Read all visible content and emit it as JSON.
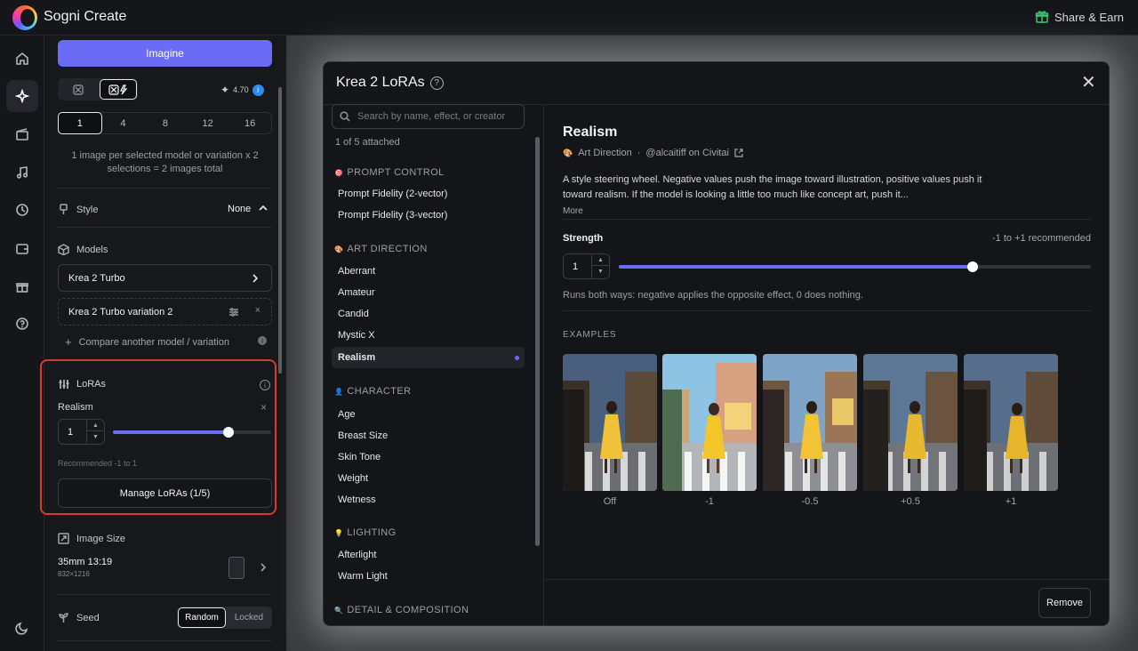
{
  "app": {
    "title": "Sogni Create",
    "share": "Share & Earn"
  },
  "rail": {
    "items": [
      "home-icon",
      "sparkle-icon",
      "clapperboard-icon",
      "music-icon",
      "history-icon",
      "wallet-icon",
      "gift-icon",
      "help-icon"
    ],
    "footer": "moon-icon"
  },
  "panel": {
    "imagine": "Imagine",
    "mode_a": "⛝",
    "mode_b": "⛝ϟ",
    "credit": "4.70",
    "counts": [
      "1",
      "4",
      "8",
      "12",
      "16"
    ],
    "selected_count": "1",
    "count_note": "1 image per selected model or variation x 2 selections = 2 images total",
    "style_label": "Style",
    "style_value": "None",
    "models_label": "Models",
    "models": [
      "Krea 2 Turbo",
      "Krea 2 Turbo variation 2"
    ],
    "compare": "Compare another model / variation",
    "loras": {
      "title": "LoRAs",
      "name": "Realism",
      "value": "1",
      "slider_fraction": 0.73,
      "recommended": "Recommended -1 to 1",
      "manage": "Manage LoRAs (1/5)"
    },
    "image_size_label": "Image Size",
    "image_size_value": "35mm 13:19",
    "image_size_dims": "832×1216",
    "seed_label": "Seed",
    "seed_options": [
      "Random",
      "Locked"
    ]
  },
  "modal": {
    "title": "Krea 2 LoRAs",
    "search_placeholder": "Search by name, effect, or creator",
    "attached": "1 of 5 attached",
    "categories": [
      {
        "name": "PROMPT CONTROL",
        "emoji": "🎯",
        "items": [
          "Prompt Fidelity (2-vector)",
          "Prompt Fidelity (3-vector)"
        ]
      },
      {
        "name": "ART DIRECTION",
        "emoji": "🎨",
        "items": [
          "Aberrant",
          "Amateur",
          "Candid",
          "Mystic X",
          "Realism"
        ]
      },
      {
        "name": "CHARACTER",
        "emoji": "👤",
        "items": [
          "Age",
          "Breast Size",
          "Skin Tone",
          "Weight",
          "Wetness"
        ]
      },
      {
        "name": "LIGHTING",
        "emoji": "💡",
        "items": [
          "Afterlight",
          "Warm Light"
        ]
      },
      {
        "name": "DETAIL & COMPOSITION",
        "emoji": "🔍",
        "items": []
      }
    ],
    "selected": "Realism",
    "detail": {
      "title": "Realism",
      "category": "Art Direction",
      "author": "@alcaitiff on Civitai",
      "description": "A style steering wheel. Negative values push the image toward illustration, positive values push it toward realism. If the model is looking a little too much like concept art, push it...",
      "more": "More",
      "strength_label": "Strength",
      "strength_range": "-1 to +1 recommended",
      "strength_value": "1",
      "strength_fraction": 0.75,
      "runs_note": "Runs both ways: negative applies the opposite effect, 0 does nothing.",
      "examples_heading": "EXAMPLES",
      "examples": [
        "Off",
        "-1",
        "-0.5",
        "+0.5",
        "+1"
      ],
      "remove": "Remove"
    }
  }
}
